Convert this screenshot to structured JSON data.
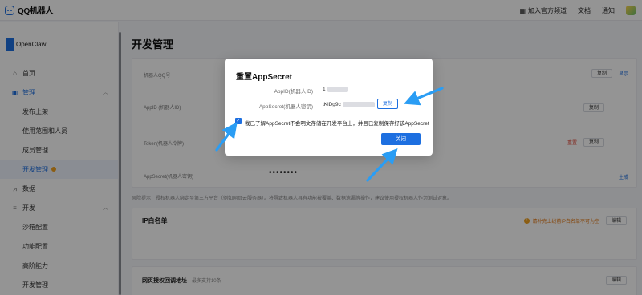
{
  "app": {
    "name": "QQ机器人"
  },
  "topnav": {
    "join_channel": "加入官方频道",
    "docs": "文档",
    "notifications": "通知"
  },
  "sidebar": {
    "workspace": "OpenClaw",
    "items": [
      {
        "label": "首页",
        "icon": "home-icon"
      },
      {
        "label": "管理",
        "icon": "manage-icon",
        "caret": "︿"
      },
      {
        "label": "发布上架"
      },
      {
        "label": "使用范围和人员"
      },
      {
        "label": "成员管理"
      },
      {
        "label": "开发管理"
      },
      {
        "label": "数据",
        "icon": "data-icon"
      },
      {
        "label": "开发",
        "icon": "dev-icon",
        "caret": "︿"
      },
      {
        "label": "沙箱配置"
      },
      {
        "label": "功能配置"
      },
      {
        "label": "高阶能力"
      },
      {
        "label": "开发管理"
      }
    ]
  },
  "main": {
    "title": "开发管理",
    "rows": [
      {
        "label": "机器人QQ号",
        "copy": "复制",
        "show": "显示"
      },
      {
        "label": "AppID (机器人ID)",
        "copy": "复制"
      },
      {
        "label": "Token(机器人令牌)",
        "reset": "重置",
        "copy": "复制"
      },
      {
        "label": "AppSecret(机器人密钥)",
        "value": "••••••••",
        "action": "生成"
      }
    ],
    "notice": "风险提示：授权机器人绑定至第三方平台（例如网页云服务器）。将导致机器人具有功能被覆盖、数据遗漏等操作，建议使用授权机器人作为测试对象。",
    "ip_title": "IP白名单",
    "ip_warn": "请补充上线前IP白名单不可为空",
    "ip_edit": "编辑",
    "webhook_title": "网页授权回调地址",
    "webhook_sub": "最多支持10条",
    "webhook_edit": "编辑"
  },
  "modal": {
    "title": "重置AppSecret",
    "appid_label": "AppID(机器人ID)",
    "appid_value": "1",
    "secret_label": "AppSecret(机器人密钥)",
    "secret_value": "tKlDg9c",
    "copy_label": "复制",
    "checkbox_checked": true,
    "checkbox_label": "我已了解AppSecret不会明文存储在开发平台上，并且已复制保存好该AppSecret",
    "close_label": "关闭"
  },
  "colors": {
    "accent": "#1d6fe0",
    "arrow": "#2a9df4"
  }
}
